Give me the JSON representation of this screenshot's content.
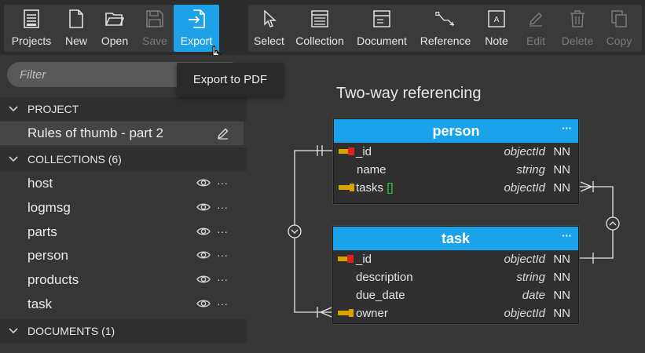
{
  "toolbar": {
    "left_group": [
      {
        "label": "Projects",
        "icon": "projects-icon",
        "state": "normal"
      },
      {
        "label": "New",
        "icon": "new-file-icon",
        "state": "normal"
      },
      {
        "label": "Open",
        "icon": "folder-open-icon",
        "state": "normal"
      },
      {
        "label": "Save",
        "icon": "save-icon",
        "state": "disabled"
      },
      {
        "label": "Export",
        "icon": "export-icon",
        "state": "active"
      }
    ],
    "right_group": [
      {
        "label": "Select",
        "icon": "cursor-icon",
        "state": "normal"
      },
      {
        "label": "Collection",
        "icon": "collection-icon",
        "state": "normal"
      },
      {
        "label": "Document",
        "icon": "document-icon",
        "state": "normal"
      },
      {
        "label": "Reference",
        "icon": "reference-icon",
        "state": "normal"
      },
      {
        "label": "Note",
        "icon": "note-icon",
        "state": "normal"
      },
      {
        "label": "Edit",
        "icon": "pencil-icon",
        "state": "disabled"
      },
      {
        "label": "Delete",
        "icon": "trash-icon",
        "state": "disabled"
      },
      {
        "label": "Copy",
        "icon": "copy-icon",
        "state": "disabled"
      }
    ]
  },
  "tooltip": {
    "text": "Export to PDF"
  },
  "sidebar": {
    "filter_placeholder": "Filter",
    "project_section": {
      "title": "PROJECT",
      "item": "Rules of thumb - part 2"
    },
    "collections_section": {
      "title": "COLLECTIONS (6)",
      "items": [
        "host",
        "logmsg",
        "parts",
        "person",
        "products",
        "task"
      ]
    },
    "documents_section": {
      "title": "DOCUMENTS (1)"
    }
  },
  "diagram": {
    "title": "Two-way referencing",
    "entities": [
      {
        "name": "person",
        "fields": [
          {
            "name": "_id",
            "type": "objectId",
            "nn": "NN",
            "key": "primary-key-icon"
          },
          {
            "name": "name",
            "type": "string",
            "nn": "NN",
            "key": ""
          },
          {
            "name": "tasks",
            "array": "[]",
            "type": "objectId",
            "nn": "NN",
            "key": "foreign-key-icon"
          }
        ]
      },
      {
        "name": "task",
        "fields": [
          {
            "name": "_id",
            "type": "objectId",
            "nn": "NN",
            "key": "primary-key-icon"
          },
          {
            "name": "description",
            "type": "string",
            "nn": "NN",
            "key": ""
          },
          {
            "name": "due_date",
            "type": "date",
            "nn": "NN",
            "key": ""
          },
          {
            "name": "owner",
            "type": "objectId",
            "nn": "NN",
            "key": "foreign-key-icon"
          }
        ]
      }
    ],
    "entity_menu": "···"
  },
  "colors": {
    "accent": "#1ea1e6",
    "entity_header": "#1aa3ea",
    "background": "#363636",
    "toolbar_bg": "#2c2c2c",
    "array_marker": "#34c759"
  }
}
